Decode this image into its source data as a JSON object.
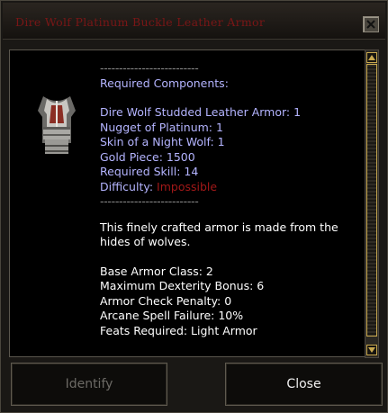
{
  "window": {
    "title": "Dire Wolf Platinum Buckle Leather Armor",
    "close_icon": "close-x-icon"
  },
  "item": {
    "icon": "leather-armor-icon",
    "separator_top": "--------------------------",
    "required_heading": "Required Components:",
    "components": [
      "Dire Wolf Studded Leather Armor: 1",
      "Nugget of Platinum: 1",
      "Skin of a Night Wolf: 1",
      "Gold Piece: 1500",
      "Required Skill: 14"
    ],
    "difficulty_label": "Difficulty:",
    "difficulty_value": "Impossible",
    "separator_bottom": "--------------------------",
    "description": "This finely crafted armor is made from the hides of wolves.",
    "stats": [
      "Base Armor Class: 2",
      "Maximum Dexterity Bonus: 6",
      "Armor Check Penalty: 0",
      "Arcane Spell Failure: 10%",
      "Feats Required: Light Armor"
    ]
  },
  "buttons": {
    "identify": "Identify",
    "close": "Close"
  },
  "colors": {
    "title": "#7a1616",
    "requirement_text": "#b4b4ff",
    "difficulty_impossible": "#a11818",
    "body_text": "#ffffff",
    "scrollbar_accent": "#c9a94f"
  }
}
